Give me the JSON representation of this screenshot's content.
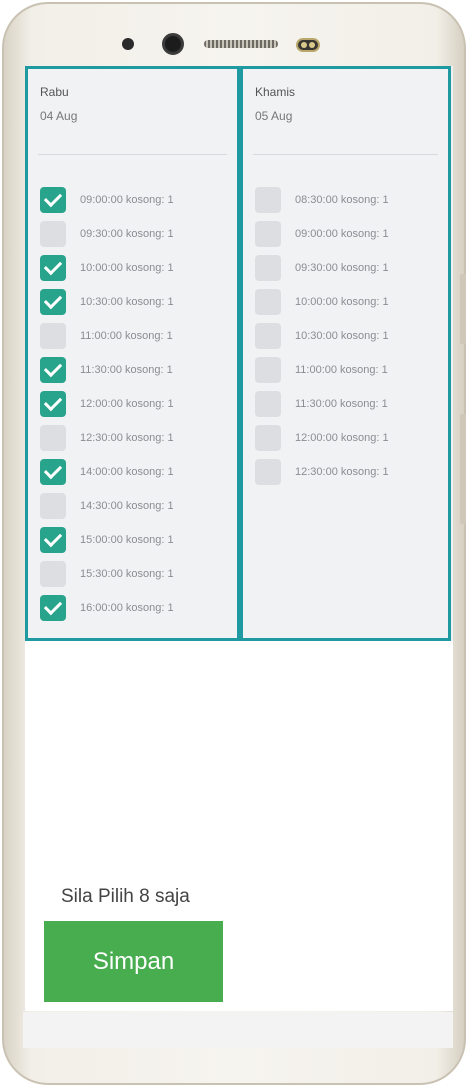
{
  "days": [
    {
      "name": "Rabu",
      "date": "04 Aug",
      "slots": [
        {
          "label": "09:00:00 kosong: 1",
          "checked": true
        },
        {
          "label": "09:30:00 kosong: 1",
          "checked": false
        },
        {
          "label": "10:00:00 kosong: 1",
          "checked": true
        },
        {
          "label": "10:30:00 kosong: 1",
          "checked": true
        },
        {
          "label": "11:00:00 kosong: 1",
          "checked": false
        },
        {
          "label": "11:30:00 kosong: 1",
          "checked": true
        },
        {
          "label": "12:00:00 kosong: 1",
          "checked": true
        },
        {
          "label": "12:30:00 kosong: 1",
          "checked": false
        },
        {
          "label": "14:00:00 kosong: 1",
          "checked": true
        },
        {
          "label": "14:30:00 kosong: 1",
          "checked": false
        },
        {
          "label": "15:00:00 kosong: 1",
          "checked": true
        },
        {
          "label": "15:30:00 kosong: 1",
          "checked": false
        },
        {
          "label": "16:00:00 kosong: 1",
          "checked": true
        }
      ]
    },
    {
      "name": "Khamis",
      "date": "05 Aug",
      "slots": [
        {
          "label": "08:30:00 kosong: 1",
          "checked": false
        },
        {
          "label": "09:00:00 kosong: 1",
          "checked": false
        },
        {
          "label": "09:30:00 kosong: 1",
          "checked": false
        },
        {
          "label": "10:00:00 kosong: 1",
          "checked": false
        },
        {
          "label": "10:30:00 kosong: 1",
          "checked": false
        },
        {
          "label": "11:00:00 kosong: 1",
          "checked": false
        },
        {
          "label": "11:30:00 kosong: 1",
          "checked": false
        },
        {
          "label": "12:00:00 kosong: 1",
          "checked": false
        },
        {
          "label": "12:30:00 kosong: 1",
          "checked": false
        }
      ]
    }
  ],
  "footer": {
    "note": "Sila Pilih 8 saja",
    "save_label": "Simpan"
  },
  "colors": {
    "accent_border": "#1f9aa0",
    "checked": "#27a48b",
    "save_button": "#47ad4e"
  }
}
